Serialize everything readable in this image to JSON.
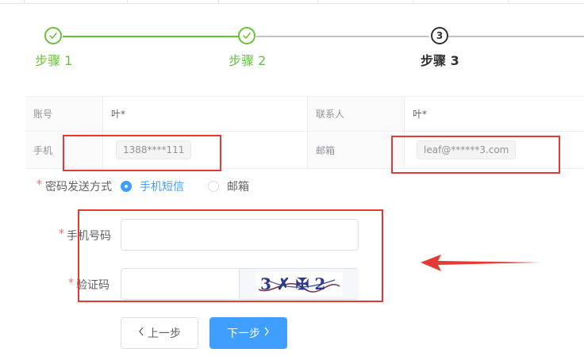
{
  "steps": [
    {
      "number": "1",
      "title": "步骤 1",
      "status": "done"
    },
    {
      "number": "2",
      "title": "步骤 2",
      "status": "done"
    },
    {
      "number": "3",
      "title": "步骤 3",
      "status": "active"
    }
  ],
  "info": {
    "account_label": "账号",
    "account_value": "叶*",
    "contact_label": "联系人",
    "contact_value": "叶*",
    "phone_label": "手机",
    "phone_value": "1388****111",
    "email_label": "邮箱",
    "email_value": "leaf@******3.com"
  },
  "form": {
    "method_label": "密码发送方式",
    "method_options": [
      {
        "label": "手机短信",
        "checked": true
      },
      {
        "label": "邮箱",
        "checked": false
      }
    ],
    "phone_label": "手机号码",
    "phone_value": "",
    "captcha_label": "验证码",
    "captcha_value": "",
    "captcha_text": "3 ✗ ✠ 2"
  },
  "buttons": {
    "prev_label": "上一步",
    "next_label": "下一步"
  },
  "colors": {
    "success": "#67c23a",
    "primary": "#409eff",
    "required": "#f56c6c",
    "annotation": "#e53935"
  }
}
